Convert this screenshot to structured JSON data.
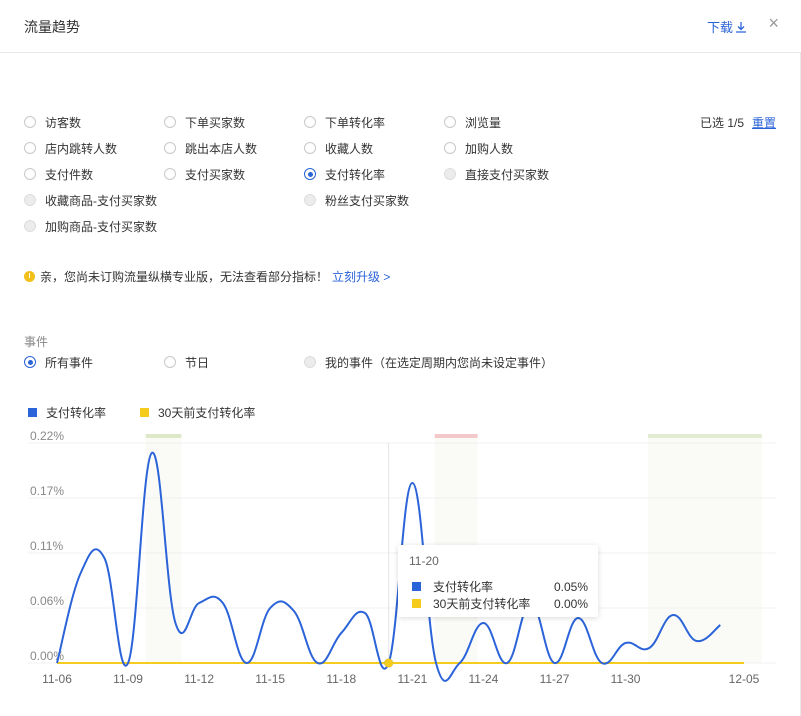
{
  "header": {
    "title": "流量趋势",
    "download_label": "下载",
    "download_icon": "download-icon",
    "close_icon": "×"
  },
  "metrics": {
    "options": [
      {
        "label": "访客数",
        "checked": false,
        "disabled": false
      },
      {
        "label": "下单买家数",
        "checked": false,
        "disabled": false
      },
      {
        "label": "下单转化率",
        "checked": false,
        "disabled": false
      },
      {
        "label": "浏览量",
        "checked": false,
        "disabled": false
      },
      {
        "label": "店内跳转人数",
        "checked": false,
        "disabled": false
      },
      {
        "label": "跳出本店人数",
        "checked": false,
        "disabled": false
      },
      {
        "label": "收藏人数",
        "checked": false,
        "disabled": false
      },
      {
        "label": "加购人数",
        "checked": false,
        "disabled": false
      },
      {
        "label": "支付件数",
        "checked": false,
        "disabled": false
      },
      {
        "label": "支付买家数",
        "checked": false,
        "disabled": false
      },
      {
        "label": "支付转化率",
        "checked": true,
        "disabled": false
      },
      {
        "label": "直接支付买家数",
        "checked": false,
        "disabled": true
      },
      {
        "label": "收藏商品-支付买家数",
        "checked": false,
        "disabled": true
      },
      {
        "label": "粉丝支付买家数",
        "checked": false,
        "disabled": true
      },
      {
        "label": "加购商品-支付买家数",
        "checked": false,
        "disabled": true
      }
    ],
    "selected_text": "已选 1/5",
    "reset_label": "重置"
  },
  "notice": {
    "text": "亲，您尚未订购流量纵横专业版，无法查看部分指标！",
    "link_label": "立刻升级 >"
  },
  "events": {
    "title": "事件",
    "options": [
      {
        "label": "所有事件",
        "checked": true,
        "disabled": false
      },
      {
        "label": "节日",
        "checked": false,
        "disabled": false
      },
      {
        "label": "我的事件（在选定周期内您尚未设定事件）",
        "checked": false,
        "disabled": true
      }
    ]
  },
  "colors": {
    "primary": "#2b63d9",
    "secondary": "#f5cb1e",
    "link": "#2b63d9"
  },
  "chart_data": {
    "type": "line",
    "x": [
      "11-06",
      "11-07",
      "11-08",
      "11-09",
      "11-10",
      "11-11",
      "11-12",
      "11-13",
      "11-14",
      "11-15",
      "11-16",
      "11-17",
      "11-18",
      "11-19",
      "11-20",
      "11-21",
      "11-22",
      "11-23",
      "11-24",
      "11-25",
      "11-26",
      "11-27",
      "11-28",
      "11-29",
      "11-30",
      "12-01",
      "12-02",
      "12-03",
      "12-04",
      "12-05"
    ],
    "xticks": [
      "11-06",
      "11-09",
      "11-12",
      "11-15",
      "11-18",
      "11-21",
      "11-24",
      "11-27",
      "11-30",
      "12-05"
    ],
    "yticks": [
      "0.22%",
      "0.17%",
      "0.11%",
      "0.06%",
      "0.00%"
    ],
    "ylim": [
      0,
      0.22
    ],
    "series": [
      {
        "name": "支付转化率",
        "color": "#2b63d9",
        "values": [
          0,
          0.09,
          0.105,
          0,
          0.21,
          0.04,
          0.06,
          0.06,
          0,
          0.055,
          0.052,
          0,
          0.03,
          0.05,
          0,
          0.18,
          0,
          0,
          0.04,
          0,
          0.06,
          0,
          0.045,
          0,
          0.02,
          0.015,
          0.048,
          0.022,
          0.038,
          null
        ]
      },
      {
        "name": "30天前支付转化率",
        "color": "#f5cb1e",
        "values": [
          0,
          0,
          0,
          0,
          0,
          0,
          0,
          0,
          0,
          0,
          0,
          0,
          0,
          0,
          0,
          0,
          0,
          0,
          0,
          0,
          0,
          0,
          0,
          0,
          0,
          0,
          0,
          0,
          0,
          0
        ]
      }
    ],
    "tooltip": {
      "date": "11-20",
      "rows": [
        {
          "name": "支付转化率",
          "value": "0.05%",
          "color": "#2b63d9"
        },
        {
          "name": "30天前支付转化率",
          "value": "0.00%",
          "color": "#f5cb1e"
        }
      ]
    }
  }
}
